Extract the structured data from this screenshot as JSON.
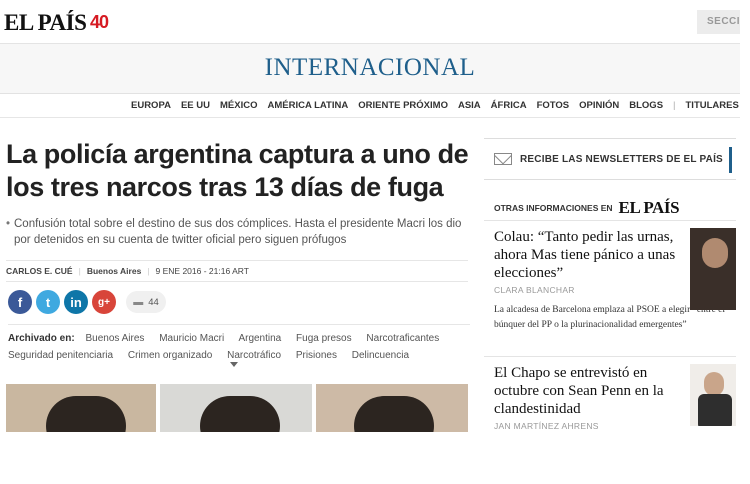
{
  "header": {
    "logo": "EL PAÍS",
    "logo_badge": "40",
    "sections_button": "SECCI"
  },
  "section": {
    "title": "INTERNACIONAL"
  },
  "nav": {
    "items": [
      "EUROPA",
      "EE UU",
      "MÉXICO",
      "AMÉRICA LATINA",
      "ORIENTE PRÓXIMO",
      "ASIA",
      "ÁFRICA",
      "FOTOS",
      "OPINIÓN",
      "BLOGS"
    ],
    "separator": "|",
    "titulares": "TITULARES »"
  },
  "article": {
    "headline": "La policía argentina captura a uno de los tres narcos tras 13 días de fuga",
    "subhead": "Confusión total sobre el destino de sus dos cómplices. Hasta el presidente Macri los dio por detenidos en su cuenta de twitter oficial pero siguen prófugos",
    "author": "CARLOS E. CUÉ",
    "location": "Buenos Aires",
    "date": "9 ENE 2016 - 21:16 ART",
    "comment_count": "44",
    "social": {
      "facebook": "f",
      "twitter": "t",
      "linkedin": "in",
      "googleplus": "g+"
    },
    "tags_label": "Archivado en:",
    "tags": [
      "Buenos Aires",
      "Mauricio Macri",
      "Argentina",
      "Fuga presos",
      "Narcotraficantes",
      "Seguridad penitenciaria",
      "Crimen organizado",
      "Narcotráfico",
      "Prisiones",
      "Delincuencia"
    ]
  },
  "sidebar": {
    "newsletter": "RECIBE LAS NEWSLETTERS DE EL PAÍS",
    "otras_label": "OTRAS INFORMACIONES EN",
    "otras_logo": "EL PAÍS",
    "stories": [
      {
        "title": "Colau: “Tanto pedir las urnas, ahora Mas tiene pánico a unas elecciones”",
        "author": "CLARA BLANCHAR",
        "description": "La alcadesa de Barcelona emplaza al PSOE a elegir “entre el búnquer del PP o la plurinacionalidad emergentes”"
      },
      {
        "title": "El Chapo se entrevistó en octubre con Sean Penn en la clandestinidad",
        "author": "JAN MARTÍNEZ AHRENS"
      }
    ]
  }
}
